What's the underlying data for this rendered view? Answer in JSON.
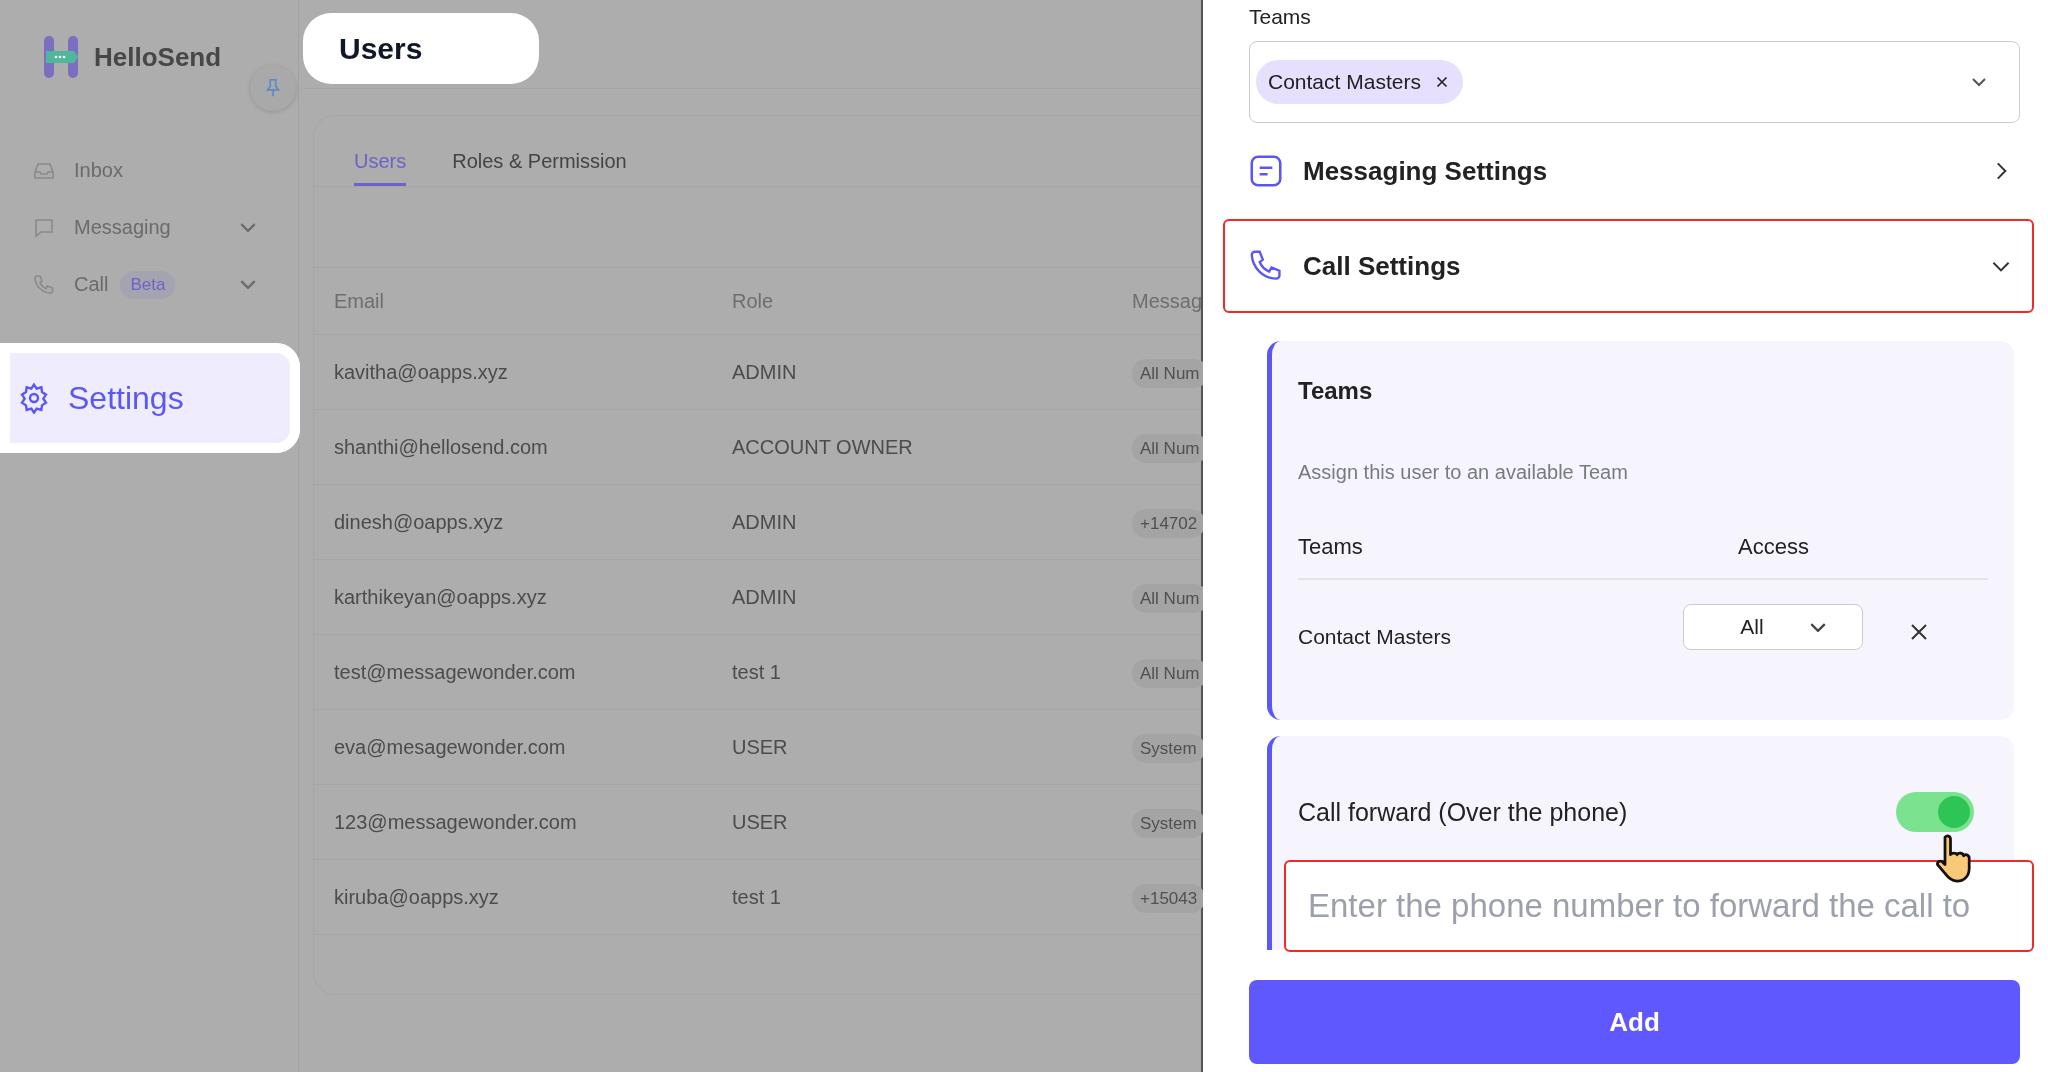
{
  "sidebar": {
    "brand": "HelloSend",
    "items": [
      {
        "label": "Inbox",
        "kind": "inbox",
        "has_caret": false,
        "selected": false
      },
      {
        "label": "Messaging",
        "kind": "message",
        "has_caret": true,
        "selected": false
      },
      {
        "label": "Call",
        "kind": "phone",
        "badge": "Beta",
        "has_caret": true,
        "selected": false
      },
      {
        "label": "Settings",
        "kind": "gear",
        "has_caret": false,
        "selected": true
      }
    ]
  },
  "page_title": "Users",
  "tabs": [
    {
      "label": "Users",
      "selected": true
    },
    {
      "label": "Roles & Permission",
      "selected": false
    }
  ],
  "table": {
    "columns": [
      "Email",
      "Role",
      "Messag"
    ],
    "rows": [
      [
        "kavitha@oapps.xyz",
        "ADMIN",
        "All Num"
      ],
      [
        "shanthi@hellosend.com",
        "ACCOUNT OWNER",
        "All Num"
      ],
      [
        "dinesh@oapps.xyz",
        "ADMIN",
        "+14702"
      ],
      [
        "karthikeyan@oapps.xyz",
        "ADMIN",
        "All Num"
      ],
      [
        "test@messagewonder.com",
        "test 1",
        "All Num"
      ],
      [
        "eva@mesagewonder.com",
        "USER",
        "System"
      ],
      [
        "123@messagewonder.com",
        "USER",
        "System"
      ],
      [
        "kiruba@oapps.xyz",
        "test 1",
        "+15043"
      ]
    ]
  },
  "panel": {
    "teams_label": "Teams",
    "teams_chips": [
      "Contact Masters"
    ],
    "sections": [
      {
        "title": "Messaging Settings",
        "kind": "message",
        "expanded": false,
        "highlighted": false
      },
      {
        "title": "Call Settings",
        "kind": "phone",
        "expanded": true,
        "highlighted": true
      }
    ],
    "teams_card": {
      "title": "Teams",
      "description": "Assign this user to an available Team",
      "col_teams": "Teams",
      "col_access": "Access",
      "rows": [
        {
          "team": "Contact Masters",
          "access": "All"
        }
      ]
    },
    "call_forward": {
      "label": "Call forward (Over the phone)",
      "on": true,
      "placeholder": "Enter the phone number to forward the call to"
    },
    "add_button": "Add"
  }
}
